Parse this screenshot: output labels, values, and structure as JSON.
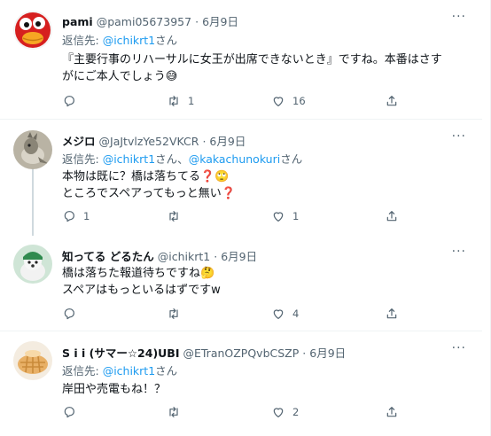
{
  "tweets": [
    {
      "name": "pami",
      "handle": "@pami05673957",
      "dot": "·",
      "date": "6月9日",
      "reply_prefix": "返信先: ",
      "reply_mentions": [
        "@ichikrt1"
      ],
      "reply_suffix": "さん",
      "body_lines": [
        "『主要行事のリハーサルに女王が出席できないとき』ですね。本番はさす",
        "がにご本人でしょう😅"
      ],
      "replies": "",
      "retweets": "1",
      "likes": "16"
    },
    {
      "name": "メジロ",
      "handle": "@JaJtvlzYe52VKCR",
      "dot": "·",
      "date": "6月9日",
      "reply_prefix": "返信先: ",
      "reply_mentions": [
        "@ichikrt1",
        "@kakachunokuri"
      ],
      "reply_joiner": "さん、",
      "reply_suffix": "さん",
      "body_lines": [
        "本物は既に？橋は落ちてる❓🙄",
        "ところでスペアってもっと無い❓"
      ],
      "replies": "1",
      "retweets": "",
      "likes": "1"
    },
    {
      "name": "知ってる どるたん",
      "handle": "@ichikrt1",
      "dot": "·",
      "date": "6月9日",
      "body_lines": [
        "橋は落ちた報道待ちですね🤔",
        "スペアはもっといるはずですw"
      ],
      "replies": "",
      "retweets": "",
      "likes": "4"
    },
    {
      "name": "S i i (サマー☆24)UBI",
      "handle": "@ETranOZPQvbCSZP",
      "dot": "·",
      "date": "6月9日",
      "reply_prefix": "返信先: ",
      "reply_mentions": [
        "@ichikrt1"
      ],
      "reply_suffix": "さん",
      "body_lines": [
        "岸田や売電もね！？"
      ],
      "replies": "",
      "retweets": "",
      "likes": "2"
    }
  ],
  "more_label": "···",
  "icons": {
    "reply": "reply-icon",
    "retweet": "retweet-icon",
    "like": "heart-icon",
    "share": "share-icon",
    "more": "more-icon"
  },
  "colors": {
    "accent": "#1d9bf0",
    "muted": "#536471",
    "thread_line": "#cfd9de"
  }
}
